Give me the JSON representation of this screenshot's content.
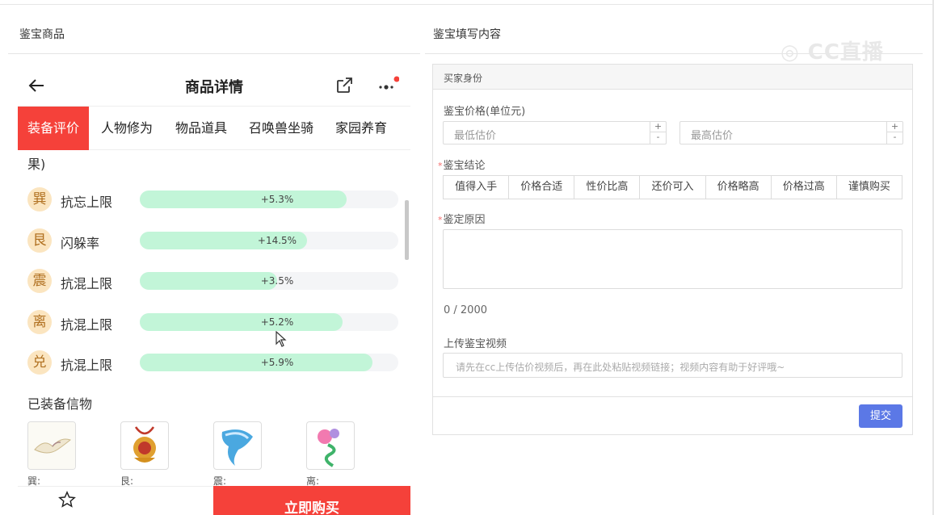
{
  "left_panel": {
    "title": "鉴宝商品",
    "nav": {
      "title": "商品详情",
      "back_icon": "arrow-left-icon",
      "share_icon": "share-icon",
      "more_icon": "more-icon"
    },
    "tabs": [
      "装备评价",
      "人物修为",
      "物品道具",
      "召唤兽坐骑",
      "家园养育"
    ],
    "active_tab": "装备评价",
    "fragment_text": "果)",
    "stats": [
      {
        "badge": "巽",
        "name": "抗忘上限",
        "value": "+5.3%",
        "fill": 0.89
      },
      {
        "badge": "艮",
        "name": "闪躲率",
        "value": "+14.5%",
        "fill": 0.72
      },
      {
        "badge": "震",
        "name": "抗混上限",
        "value": "+3.5%",
        "fill": 0.59
      },
      {
        "badge": "离",
        "name": "抗混上限",
        "value": "+5.2%",
        "fill": 0.87
      },
      {
        "badge": "兑",
        "name": "抗混上限",
        "value": "+5.9%",
        "fill": 1.0
      }
    ],
    "equipped_label": "已装备信物",
    "items": [
      {
        "caption": "巽:",
        "icon": "crane-icon"
      },
      {
        "caption": "艮:",
        "icon": "lion-ornament-icon"
      },
      {
        "caption": "震:",
        "icon": "conch-icon"
      },
      {
        "caption": "离:",
        "icon": "flower-icon"
      }
    ],
    "favorite_icon": "star-icon",
    "buy_label": "立即购买"
  },
  "form": {
    "title": "鉴宝填写内容",
    "section": "买家身份",
    "price_label": "鉴宝价格(单位元)",
    "min_placeholder": "最低估价",
    "max_placeholder": "最高估价",
    "conclusion_label": "鉴宝结论",
    "conclusions": [
      "值得入手",
      "价格合适",
      "性价比高",
      "还价可入",
      "价格略高",
      "价格过高",
      "谨慎购买"
    ],
    "reason_label": "鉴定原因",
    "counter": "0 / 2000",
    "video_label": "上传鉴宝视频",
    "video_placeholder": "请先在cc上传估价视频后，再在此处粘贴视频链接；视频内容有助于好评哦~",
    "submit_label": "提交",
    "required_mark": "*"
  },
  "colors": {
    "accent_red": "#f5413a",
    "bar_green": "#c2f5d8",
    "submit_blue": "#5b78e6"
  }
}
